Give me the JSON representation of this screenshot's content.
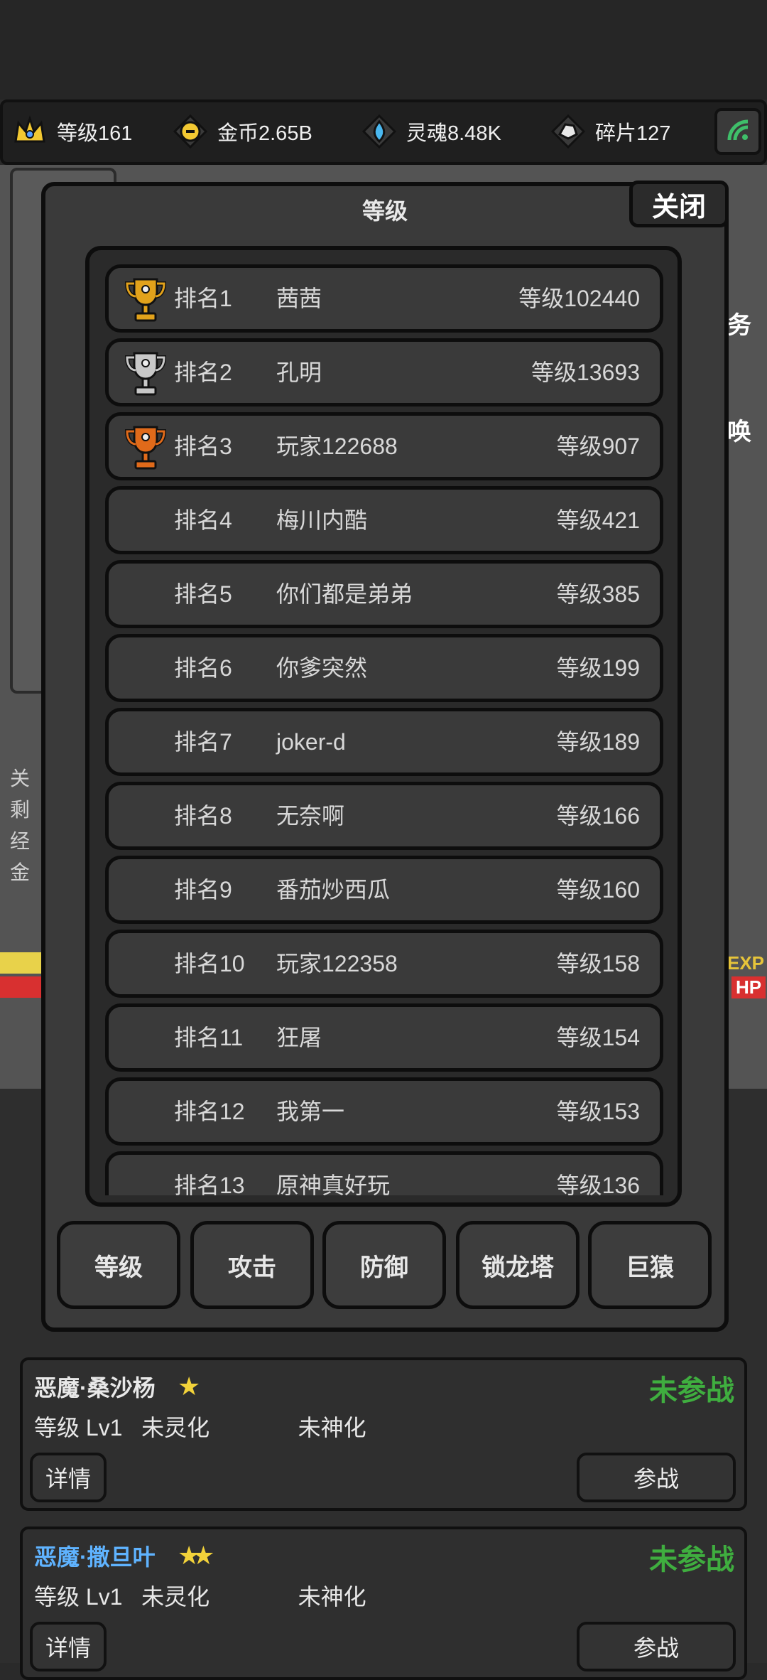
{
  "resources": [
    {
      "icon": "crown-icon",
      "label": "等级161"
    },
    {
      "icon": "gold-coin-icon",
      "label": "金币2.65B"
    },
    {
      "icon": "soul-flame-icon",
      "label": "灵魂8.48K"
    },
    {
      "icon": "fragment-icon",
      "label": "碎片127"
    }
  ],
  "background": {
    "side_lines": [
      "关",
      "剩",
      "经",
      "金"
    ],
    "right_labels": [
      "务",
      "唤"
    ],
    "exp_label": "EXP",
    "hp_label": "HP"
  },
  "modal": {
    "title": "等级",
    "close_label": "关闭",
    "rows": [
      {
        "rank": "排名1",
        "name": "茜茜",
        "level": "等级102440",
        "trophy": "gold"
      },
      {
        "rank": "排名2",
        "name": "孔明",
        "level": "等级13693",
        "trophy": "silver"
      },
      {
        "rank": "排名3",
        "name": "玩家122688",
        "level": "等级907",
        "trophy": "bronze"
      },
      {
        "rank": "排名4",
        "name": "梅川内酷",
        "level": "等级421",
        "trophy": ""
      },
      {
        "rank": "排名5",
        "name": "你们都是弟弟",
        "level": "等级385",
        "trophy": ""
      },
      {
        "rank": "排名6",
        "name": "你爹突然",
        "level": "等级199",
        "trophy": ""
      },
      {
        "rank": "排名7",
        "name": "joker-d",
        "level": "等级189",
        "trophy": ""
      },
      {
        "rank": "排名8",
        "name": "无奈啊",
        "level": "等级166",
        "trophy": ""
      },
      {
        "rank": "排名9",
        "name": "番茄炒西瓜",
        "level": "等级160",
        "trophy": ""
      },
      {
        "rank": "排名10",
        "name": "玩家122358",
        "level": "等级158",
        "trophy": ""
      },
      {
        "rank": "排名11",
        "name": "狂屠",
        "level": "等级154",
        "trophy": ""
      },
      {
        "rank": "排名12",
        "name": "我第一",
        "level": "等级153",
        "trophy": ""
      },
      {
        "rank": "排名13",
        "name": "原神真好玩",
        "level": "等级136",
        "trophy": ""
      }
    ],
    "tabs": [
      "等级",
      "攻击",
      "防御",
      "锁龙塔",
      "巨猿"
    ]
  },
  "heroes": [
    {
      "name": "恶魔·桑沙杨",
      "stars": "★",
      "status": "未参战",
      "info": "等级 Lv1   未灵化              未神化",
      "detail_label": "详情",
      "join_label": "参战"
    },
    {
      "name": "恶魔·撒旦叶",
      "stars": "★★",
      "status": "未参战",
      "info": "等级 Lv1   未灵化              未神化",
      "detail_label": "详情",
      "join_label": "参战"
    }
  ],
  "colors": {
    "gold": "#e2a21b",
    "silver": "#c8c8c8",
    "bronze": "#e06a1a",
    "status_green": "#3fae3f",
    "hero_blue": "#5fb3ff"
  }
}
